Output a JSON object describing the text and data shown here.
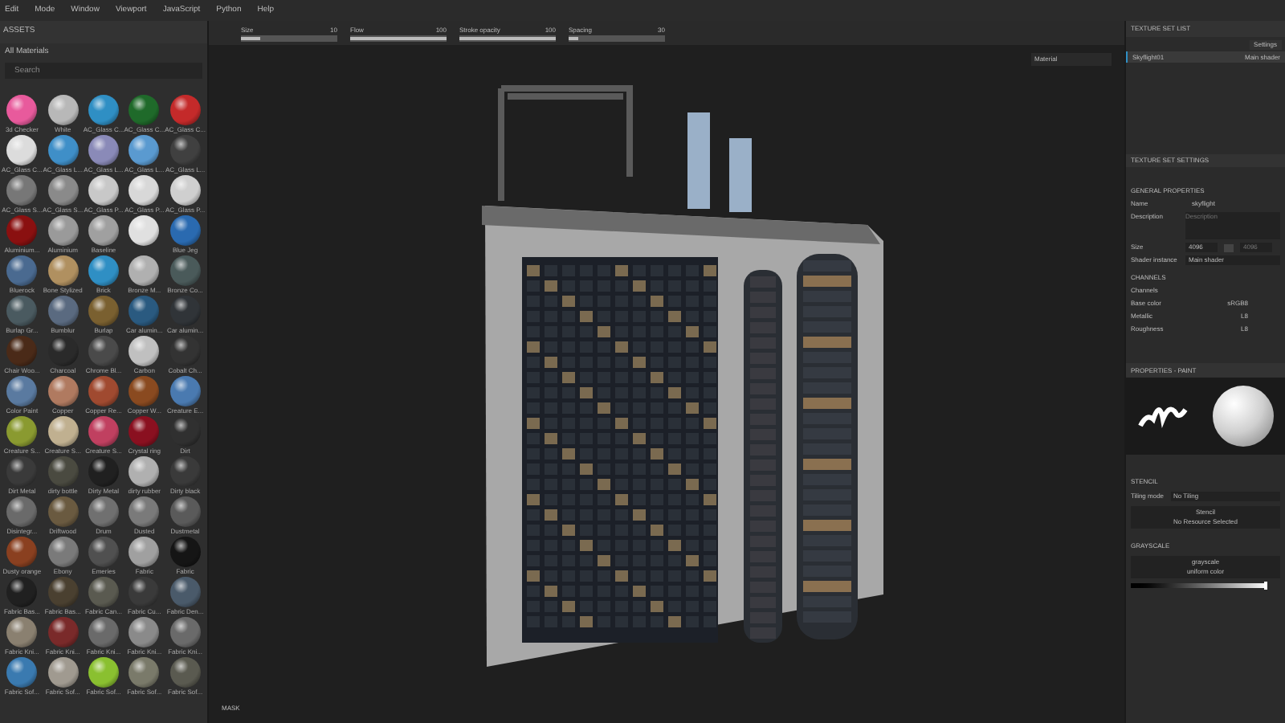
{
  "menu": [
    "Edit",
    "Mode",
    "Window",
    "Viewport",
    "JavaScript",
    "Python",
    "Help"
  ],
  "assets": {
    "title": "ASSETS",
    "filter": "All Materials",
    "search": {
      "placeholder": "Search"
    },
    "materials": [
      {
        "label": "3d Checker",
        "color": "#e85a9c"
      },
      {
        "label": "White",
        "color": "#b8b8b8"
      },
      {
        "label": "AC_Glass C...",
        "color": "#2f8fc4"
      },
      {
        "label": "AC_Glass C...",
        "color": "#1f6a2a"
      },
      {
        "label": "AC_Glass C...",
        "color": "#c42a2a"
      },
      {
        "label": "AC_Glass C...",
        "color": "#dcdcdc"
      },
      {
        "label": "AC_Glass L...",
        "color": "#3f8fc8"
      },
      {
        "label": "AC_Glass L...",
        "color": "#8a8ab8"
      },
      {
        "label": "AC_Glass L...",
        "color": "#5a9ad0"
      },
      {
        "label": "AC_Glass L...",
        "color": "#404040"
      },
      {
        "label": "AC_Glass S...",
        "color": "#777777"
      },
      {
        "label": "AC_Glass S...",
        "color": "#8a8a8a"
      },
      {
        "label": "AC_Glass P...",
        "color": "#c8c8c8"
      },
      {
        "label": "AC_Glass P...",
        "color": "#d8d8d8"
      },
      {
        "label": "AC_Glass P...",
        "color": "#cfcfcf"
      },
      {
        "label": "Aluminium...",
        "color": "#8a1010"
      },
      {
        "label": "Aluminium",
        "color": "#9a9a9a"
      },
      {
        "label": "Baseline",
        "color": "#a0a0a0"
      },
      {
        "color": "#e0e0e0"
      },
      {
        "label": "Blue Jeg",
        "color": "#2a6ab0"
      },
      {
        "label": "Bluerock",
        "color": "#4a6a90"
      },
      {
        "label": "Bone Stylized",
        "color": "#b09060"
      },
      {
        "label": "Brick",
        "color": "#2f8fc4"
      },
      {
        "label": "Bronze M...",
        "color": "#b0b0b0"
      },
      {
        "label": "Bronze Co...",
        "color": "#4a5a5a"
      },
      {
        "label": "Burlap Gr...",
        "color": "#4a5a60"
      },
      {
        "label": "Bumblur",
        "color": "#5a6a80"
      },
      {
        "label": "Burlap",
        "color": "#7a6030"
      },
      {
        "label": "Car alumin...",
        "color": "#2a5a80"
      },
      {
        "label": "Car alumin...",
        "color": "#303438"
      },
      {
        "label": "Chair Woo...",
        "color": "#4a2a18"
      },
      {
        "label": "Charcoal",
        "color": "#2a2a2a"
      },
      {
        "label": "Chrome Bl...",
        "color": "#4a4a4a"
      },
      {
        "label": "Carbon",
        "color": "#c0c0c0"
      },
      {
        "label": "Cobalt Ch...",
        "color": "#333333"
      },
      {
        "label": "Color Paint",
        "color": "#5a7aa0"
      },
      {
        "label": "Copper",
        "color": "#b07a60"
      },
      {
        "label": "Copper Re...",
        "color": "#a04a30"
      },
      {
        "label": "Copper W...",
        "color": "#8a4a20"
      },
      {
        "label": "Creature E...",
        "color": "#4a7ab0"
      },
      {
        "label": "Creature S...",
        "color": "#8a9a30"
      },
      {
        "label": "Creature S...",
        "color": "#c0b090"
      },
      {
        "label": "Creature S...",
        "color": "#c04060"
      },
      {
        "label": "Crystal ring",
        "color": "#8a1020"
      },
      {
        "label": "Dirt",
        "color": "#303030"
      },
      {
        "label": "Dirt Metal",
        "color": "#3a3a3a"
      },
      {
        "label": "dirty bottle",
        "color": "#4a4a40"
      },
      {
        "label": "Dirty Metal",
        "color": "#202020"
      },
      {
        "label": "dirty rubber",
        "color": "#b0b0b0"
      },
      {
        "label": "Dirty black",
        "color": "#3a3a3a"
      },
      {
        "label": "Disintegr...",
        "color": "#6a6a6a"
      },
      {
        "label": "Driftwood",
        "color": "#6a5a40"
      },
      {
        "label": "Drum",
        "color": "#707070"
      },
      {
        "label": "Dusted",
        "color": "#7a7a7a"
      },
      {
        "label": "Dustmetal",
        "color": "#5a5a5a"
      },
      {
        "label": "Dusty orange",
        "color": "#8a4020"
      },
      {
        "label": "Ebony",
        "color": "#7a7a7a"
      },
      {
        "label": "Emeries",
        "color": "#505050"
      },
      {
        "label": "Fabric",
        "color": "#a0a0a0"
      },
      {
        "label": "Fabric",
        "color": "#151515"
      },
      {
        "label": "Fabric Bas...",
        "color": "#202020"
      },
      {
        "label": "Fabric Bas...",
        "color": "#4a4030"
      },
      {
        "label": "Fabric Can...",
        "color": "#5a5a50"
      },
      {
        "label": "Fabric Cu...",
        "color": "#3a3a3a"
      },
      {
        "label": "Fabric Den...",
        "color": "#4a5a6a"
      },
      {
        "label": "Fabric Kni...",
        "color": "#8a8070"
      },
      {
        "label": "Fabric Kni...",
        "color": "#7a2a2a"
      },
      {
        "label": "Fabric Kni...",
        "color": "#6a6a6a"
      },
      {
        "label": "Fabric Kni...",
        "color": "#8a8a8a"
      },
      {
        "label": "Fabric Kni...",
        "color": "#6a6a6a"
      },
      {
        "label": "Fabric Sof...",
        "color": "#3a7ab0"
      },
      {
        "label": "Fabric Sof...",
        "color": "#a09a90"
      },
      {
        "label": "Fabric Sof...",
        "color": "#8ac030"
      },
      {
        "label": "Fabric Sof...",
        "color": "#7a7a6a"
      },
      {
        "label": "Fabric Sof...",
        "color": "#5a5a50"
      }
    ]
  },
  "toolbar": [
    {
      "label": "Size",
      "value": "10",
      "level": 0.2
    },
    {
      "label": "Flow",
      "value": "100",
      "level": 1
    },
    {
      "label": "Stroke opacity",
      "value": "100",
      "level": 1
    },
    {
      "label": "Spacing",
      "value": "30",
      "level": 0.1
    }
  ],
  "viewport": {
    "mode": "Material",
    "mask": "MASK"
  },
  "texture_set_list": {
    "title": "TEXTURE SET LIST",
    "settings": "Settings",
    "rows": [
      {
        "name": "Skyflight01",
        "shader": "Main shader",
        "selected": true
      }
    ]
  },
  "texture_set_settings": {
    "title": "TEXTURE SET SETTINGS",
    "section": "GENERAL PROPERTIES",
    "name_label": "Name",
    "name": "skyflight",
    "description_label": "Description",
    "description": {
      "placeholder": "Description"
    },
    "size_label": "Size",
    "size": "4096",
    "size2": "4096",
    "shader_label": "Shader instance",
    "shader": "Main shader",
    "channels_title": "CHANNELS",
    "channels_label": "Channels",
    "channels": [
      {
        "name": "Base color",
        "format": "sRGB8"
      },
      {
        "name": "Metallic",
        "format": "L8"
      },
      {
        "name": "Roughness",
        "format": "L8"
      }
    ]
  },
  "properties": {
    "title": "PROPERTIES - PAINT",
    "stencil": "STENCIL",
    "tiling_label": "Tiling mode",
    "tiling": "No Tiling",
    "stencil_name": "Stencil",
    "stencil_resource": "No Resource Selected",
    "grayscale": "GRAYSCALE",
    "gray_name": "grayscale",
    "gray_sub": "uniform color",
    "level": 0.98
  }
}
